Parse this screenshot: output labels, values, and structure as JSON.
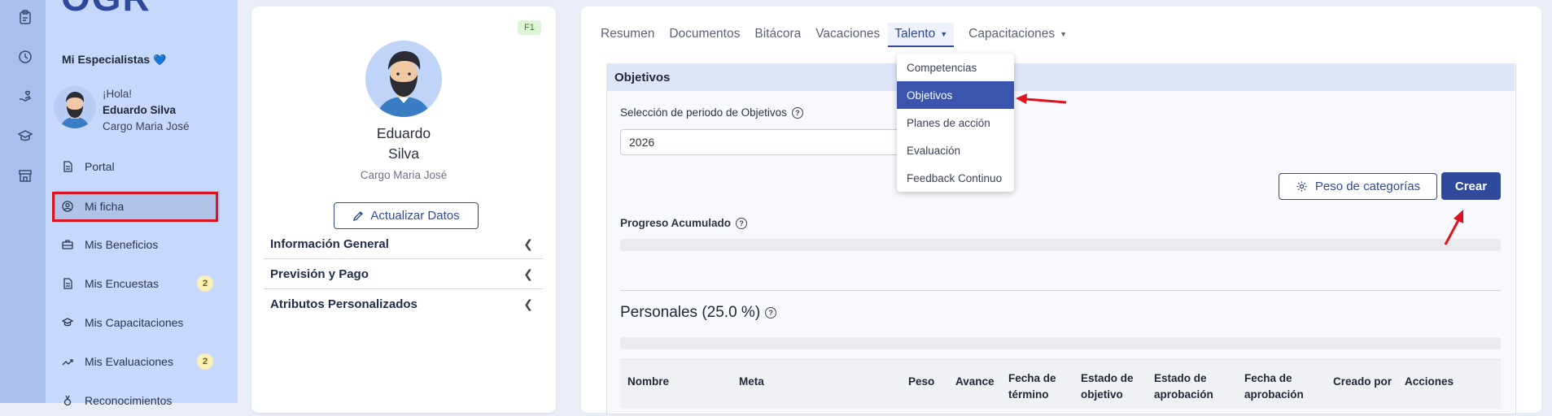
{
  "sidebar": {
    "logo": "OGR",
    "spec_title": "Mi Especialistas",
    "heart": "💙",
    "greeting": "¡Hola!",
    "user_name": "Eduardo Silva",
    "user_role": "Cargo Maria José",
    "items": [
      {
        "label": "Portal",
        "icon": "document-icon"
      },
      {
        "label": "Mi ficha",
        "icon": "user-circle-icon"
      },
      {
        "label": "Mis Beneficios",
        "icon": "briefcase-icon"
      },
      {
        "label": "Mis Encuestas",
        "icon": "document-icon",
        "badge": "2"
      },
      {
        "label": "Mis Capacitaciones",
        "icon": "graduation-cap-icon"
      },
      {
        "label": "Mis Evaluaciones",
        "icon": "trend-icon",
        "badge": "2"
      },
      {
        "label": "Reconocimientos",
        "icon": "medal-icon"
      }
    ]
  },
  "rail_icons": [
    "clipboard-icon",
    "clock-icon",
    "hand-heart-icon",
    "graduation-cap-icon",
    "store-icon"
  ],
  "profile": {
    "badge": "F1",
    "first_name": "Eduardo",
    "last_name": "Silva",
    "role": "Cargo Maria José",
    "update_button": "Actualizar Datos",
    "sections": [
      "Información General",
      "Previsión y Pago",
      "Atributos Personalizados"
    ]
  },
  "tabs": [
    {
      "label": "Resumen"
    },
    {
      "label": "Documentos"
    },
    {
      "label": "Bitácora"
    },
    {
      "label": "Vacaciones"
    },
    {
      "label": "Talento",
      "active": true,
      "dropdown": true
    },
    {
      "label": "Capacitaciones",
      "dropdown": true
    }
  ],
  "dropdown": {
    "items": [
      "Competencias",
      "Objetivos",
      "Planes de acción",
      "Evaluación",
      "Feedback Continuo"
    ],
    "selected": "Objetivos"
  },
  "objectives": {
    "header": "Objetivos",
    "period_label": "Selección de periodo de Objetivos",
    "period_value": "2026",
    "peso_button": "Peso de categorías",
    "crear_button": "Crear",
    "progress_label": "Progreso Acumulado",
    "section_title": "Personales (25.0 %)",
    "columns": [
      {
        "line1": "Nombre",
        "line2": ""
      },
      {
        "line1": "Meta",
        "line2": ""
      },
      {
        "line1": "Peso",
        "line2": ""
      },
      {
        "line1": "Avance",
        "line2": ""
      },
      {
        "line1": "Fecha de",
        "line2": "término"
      },
      {
        "line1": "Estado de",
        "line2": "objetivo"
      },
      {
        "line1": "Estado de",
        "line2": "aprobación"
      },
      {
        "line1": "Fecha de",
        "line2": "aprobación"
      },
      {
        "line1": "Creado por",
        "line2": ""
      },
      {
        "line1": "Acciones",
        "line2": ""
      }
    ]
  },
  "colors": {
    "accent": "#2f4a9a",
    "highlight_red": "#e0121e",
    "sidebar_bg": "#c6d8fb",
    "badge_bg": "#fbf0b5"
  }
}
